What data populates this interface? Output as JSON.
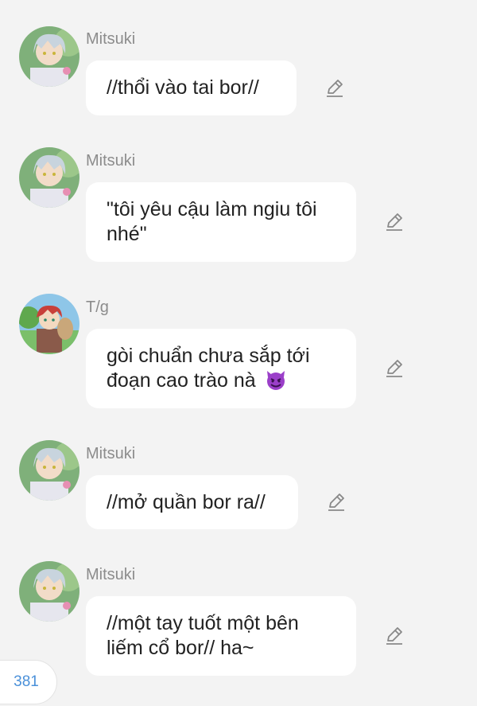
{
  "messages": [
    {
      "sender": "Mitsuki",
      "avatar": "mitsuki-avatar",
      "text": "//thổi vào tai bor//"
    },
    {
      "sender": "Mitsuki",
      "avatar": "mitsuki-avatar",
      "text": "\"tôi yêu cậu làm ngiu tôi nhé\""
    },
    {
      "sender": "T/g",
      "avatar": "gaara-avatar",
      "text": "gòi chuẩn chưa sắp tới đoạn cao trào nà",
      "emoji": "smiling-devil-emoji"
    },
    {
      "sender": "Mitsuki",
      "avatar": "mitsuki-avatar",
      "text": "//mở quần bor ra//"
    },
    {
      "sender": "Mitsuki",
      "avatar": "mitsuki-avatar",
      "text": "//một tay tuốt một bên liếm cổ bor// ha~"
    }
  ],
  "counter": "381",
  "icons": {
    "edit": "pencil-edit-icon"
  },
  "colors": {
    "background": "#f3f3f3",
    "bubble": "#ffffff",
    "name": "#8c8c8c",
    "counter": "#4a90d9",
    "devil": "#9b3fc9"
  }
}
